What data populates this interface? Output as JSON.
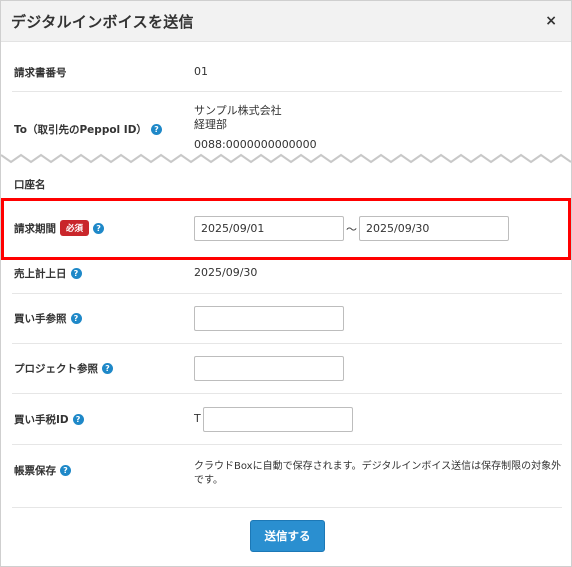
{
  "dialog": {
    "title": "デジタルインボイスを送信",
    "close_label": "×"
  },
  "fields": {
    "invoice_number": {
      "label": "請求書番号",
      "value": "01"
    },
    "to": {
      "label": "To（取引先のPeppol ID）",
      "company": "サンプル株式会社",
      "department": "経理部",
      "peppol_id": "0088:0000000000000"
    },
    "account_name": {
      "label": "口座名"
    },
    "billing_period": {
      "label": "請求期間",
      "required_badge": "必須",
      "start": "2025/09/01",
      "separator": "～",
      "end": "2025/09/30"
    },
    "sales_date": {
      "label": "売上計上日",
      "value": "2025/09/30"
    },
    "buyer_reference": {
      "label": "買い手参照",
      "value": ""
    },
    "project_reference": {
      "label": "プロジェクト参照",
      "value": ""
    },
    "buyer_tax_id": {
      "label": "買い手税ID",
      "prefix": "T",
      "value": ""
    },
    "ledger_storage": {
      "label": "帳票保存",
      "line1": "クラウドBoxに自動で保存されます。デジタルインボイス送信は保存制限の対象外",
      "line2": "です。"
    }
  },
  "help_icon_glyph": "?",
  "submit_label": "送信する",
  "colors": {
    "accent": "#2a8fd0",
    "help_icon": "#1e88c8",
    "required_badge": "#c9262b",
    "highlight_border": "#ff0000"
  }
}
